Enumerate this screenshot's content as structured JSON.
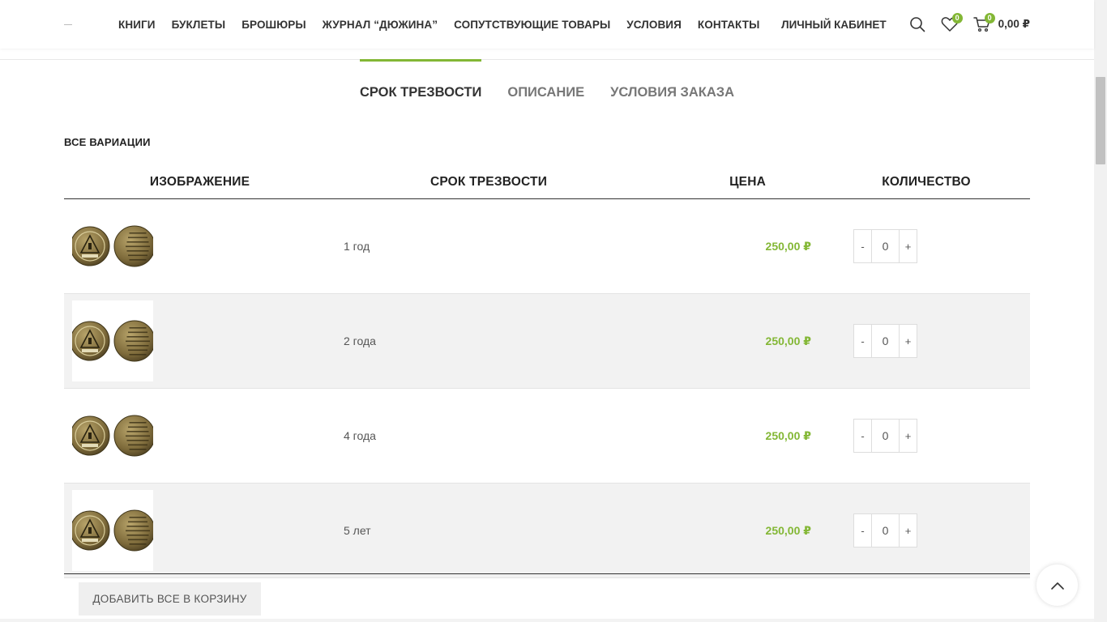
{
  "colors": {
    "accent": "#83b735",
    "text": "#333333",
    "muted": "#777777"
  },
  "header": {
    "nav": [
      {
        "label": "КНИГИ"
      },
      {
        "label": "БУКЛЕТЫ"
      },
      {
        "label": "БРОШЮРЫ"
      },
      {
        "label": "ЖУРНАЛ “ДЮЖИНА”"
      },
      {
        "label": "СОПУТСТВУЮЩИЕ ТОВАРЫ"
      },
      {
        "label": "УСЛОВИЯ"
      },
      {
        "label": "КОНТАКТЫ"
      }
    ],
    "account_label": "ЛИЧНЫЙ КАБИНЕТ",
    "search_icon": "search-icon",
    "wishlist_icon": "heart-icon",
    "wishlist_count": "0",
    "cart_icon": "cart-icon",
    "cart_count": "0",
    "cart_total": "0,00 ₽"
  },
  "tabs": [
    {
      "label": "СРОК ТРЕЗВОСТИ",
      "active": true
    },
    {
      "label": "ОПИСАНИЕ",
      "active": false
    },
    {
      "label": "УСЛОВИЯ ЗАКАЗА",
      "active": false
    }
  ],
  "variations": {
    "title": "ВСЕ ВАРИАЦИИ",
    "columns": {
      "image": "ИЗОБРАЖЕНИЕ",
      "term": "СРОК ТРЕЗВОСТИ",
      "price": "ЦЕНА",
      "quantity": "КОЛИЧЕСТВО"
    },
    "rows": [
      {
        "term": "1 год",
        "price": "250,00 ₽",
        "qty": "0",
        "minus": "-",
        "plus": "+"
      },
      {
        "term": "2 года",
        "price": "250,00 ₽",
        "qty": "0",
        "minus": "-",
        "plus": "+"
      },
      {
        "term": "4 года",
        "price": "250,00 ₽",
        "qty": "0",
        "minus": "-",
        "plus": "+"
      },
      {
        "term": "5 лет",
        "price": "250,00 ₽",
        "qty": "0",
        "minus": "-",
        "plus": "+"
      }
    ],
    "add_all_label": "ДОБАВИТЬ ВСЕ В КОРЗИНУ"
  },
  "scroll_top_icon": "chevron-up-icon"
}
